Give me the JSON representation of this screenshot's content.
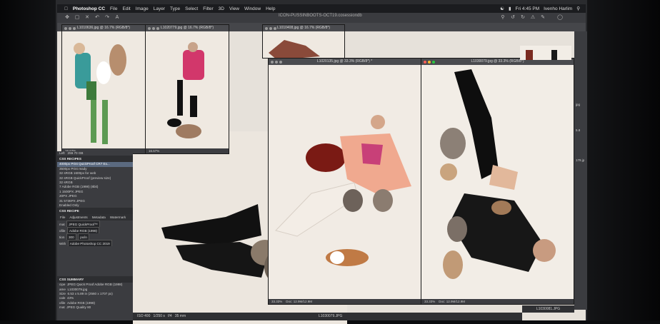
{
  "menubar": {
    "apple": "",
    "app_name": "Photoshop CC",
    "items": [
      "File",
      "Edit",
      "Image",
      "Layer",
      "Type",
      "Select",
      "Filter",
      "3D",
      "View",
      "Window",
      "Help"
    ],
    "clock": "Fri 4:45 PM",
    "user": "Ivenho Harlim"
  },
  "document_title": "ICON-PUSSINBOOTS-OCT19.cosessiondb",
  "windows": {
    "w1": {
      "title": "L1010636.jpg @ 16.7% (RGB/8*)",
      "zoom": "16.67%"
    },
    "w2": {
      "title": "L1020779.jpg @ 16.7% (RGB/8*)",
      "zoom": "16.67%"
    },
    "w3": {
      "title": "L1010408.jpg @ 16.7% (RGB/8*)"
    },
    "w4": {
      "title": "L1020135.jpg @ 33.3% (RGB/8*) *",
      "zoom": "33.33%",
      "doc": "Doc: 12.9M/12.9M"
    },
    "w5": {
      "title": "L1030079.jpg @ 33.3% (RGB/8*)",
      "zoom": "33.33%",
      "doc": "Doc: 12.9M/12.9M"
    }
  },
  "panel": {
    "left_label": "Left",
    "left_value": "259.70 GB",
    "recipes_header": "CSS RECIPES",
    "recipes": [
      "4000px Print QuickProof CR7 Ex...",
      "3500px Print ready",
      "32 sRGB 1600px for web",
      "32 sRGB QuickProof (preview size)",
      "32 sRGB",
      "7 Adobe RGB (1998) (8bit)",
      "1 1500PX JPEG",
      "20PX JPEG",
      "31 5736PX JPEG"
    ],
    "enabled_only": "Enabled Only",
    "recipe_header": "CSS RECIPE",
    "tabs": [
      "File",
      "Adjustments",
      "Metadata",
      "Watermark"
    ],
    "format_label": "mat",
    "format_value": "JPEG QuickProof™",
    "profile_label": "ofile",
    "profile_value": "Adobe RGB (1998)",
    "res_label": "tion",
    "res_value": "300",
    "res_unit": "px/in",
    "open_label": "With",
    "open_value": "Adobe Photoshop CC 2019",
    "summary_header": "CSS SUMMARY",
    "summary": [
      [
        "cipe",
        "JPEG Quick Proof Adobe RGB (1998)"
      ],
      [
        "ame",
        "L1030079.jpg"
      ],
      [
        "Size",
        "6.53 x 5.89 in (2560 x 1707 px)"
      ],
      [
        "cale",
        "43%"
      ],
      [
        "ofile",
        "Adobe RGB (1998)"
      ],
      [
        "mat",
        "JPEG Quality 80"
      ]
    ]
  },
  "bottom_bar": {
    "iso": "ISO 400",
    "shutter": "1/250 s",
    "aperture": "f/4",
    "focal": "35 mm",
    "filename": "L1030079.JPG"
  },
  "thumb_label": "L1030081.JPG",
  "right_labels": [
    "jpg",
    "5.8",
    "179.jp"
  ]
}
